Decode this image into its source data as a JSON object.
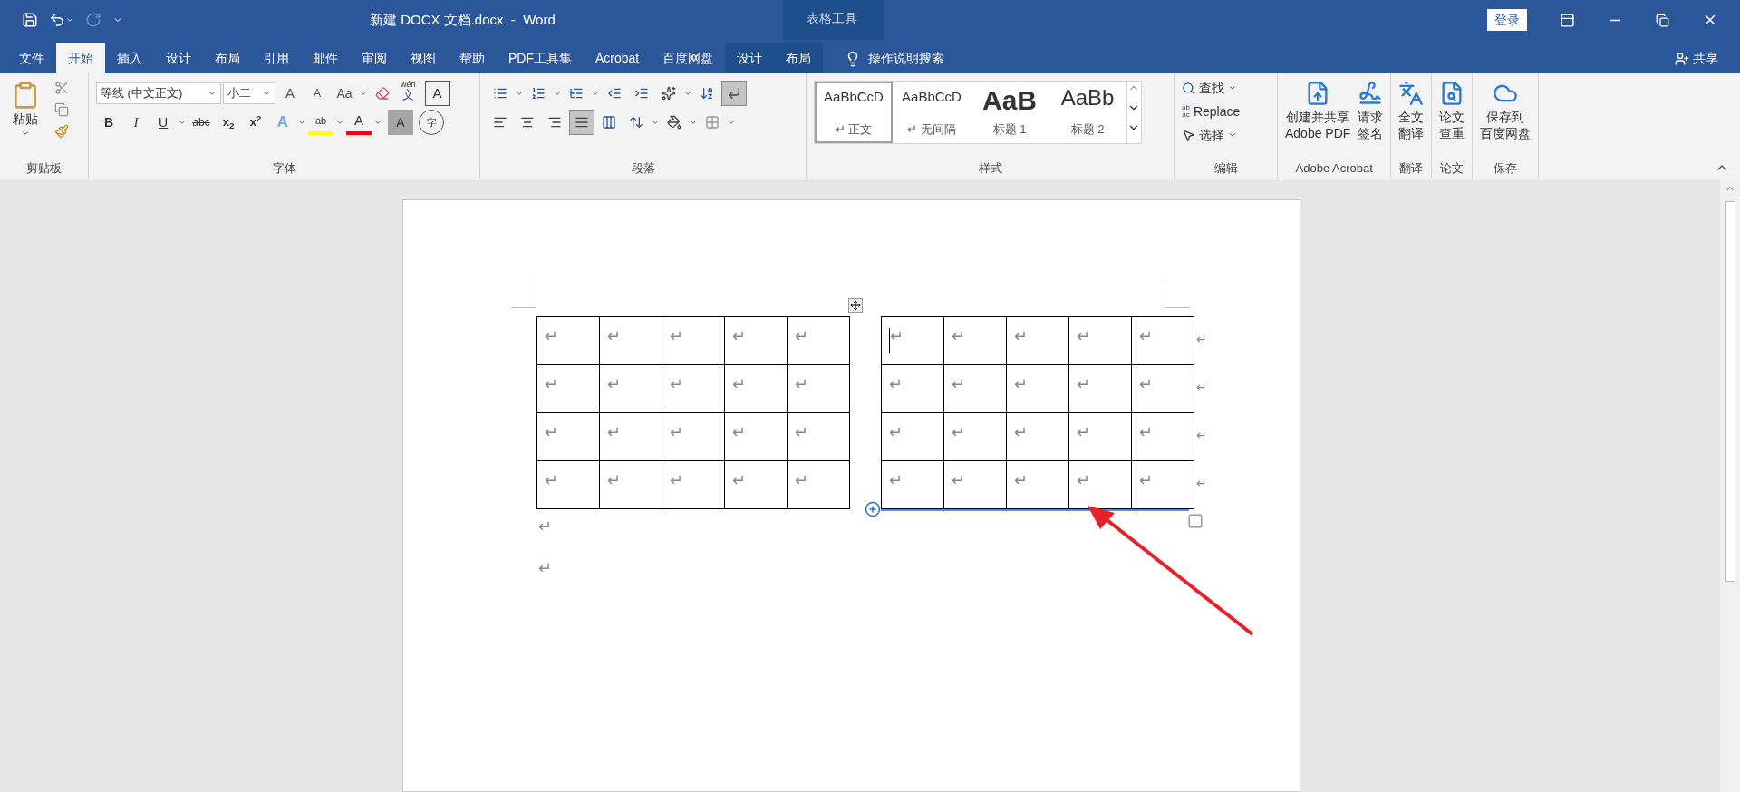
{
  "title_bar": {
    "title": "新建 DOCX 文档.docx  -  Word",
    "context_group": "表格工具",
    "sign_in": "登录"
  },
  "tabs": [
    {
      "label": "文件",
      "selected": false,
      "contextual": false
    },
    {
      "label": "开始",
      "selected": true,
      "contextual": false
    },
    {
      "label": "插入",
      "selected": false,
      "contextual": false
    },
    {
      "label": "设计",
      "selected": false,
      "contextual": false
    },
    {
      "label": "布局",
      "selected": false,
      "contextual": false
    },
    {
      "label": "引用",
      "selected": false,
      "contextual": false
    },
    {
      "label": "邮件",
      "selected": false,
      "contextual": false
    },
    {
      "label": "审阅",
      "selected": false,
      "contextual": false
    },
    {
      "label": "视图",
      "selected": false,
      "contextual": false
    },
    {
      "label": "帮助",
      "selected": false,
      "contextual": false
    },
    {
      "label": "PDF工具集",
      "selected": false,
      "contextual": false
    },
    {
      "label": "Acrobat",
      "selected": false,
      "contextual": false
    },
    {
      "label": "百度网盘",
      "selected": false,
      "contextual": false
    },
    {
      "label": "设计",
      "selected": false,
      "contextual": true
    },
    {
      "label": "布局",
      "selected": false,
      "contextual": true
    }
  ],
  "tell_me": "操作说明搜索",
  "share": "共享",
  "clipboard": {
    "paste": "粘贴",
    "label": "剪贴板"
  },
  "font": {
    "font_name": "等线 (中文正文)",
    "font_size": "小二",
    "grow": "A",
    "shrink": "A",
    "change_case": "Aa",
    "phonetic_top": "wén",
    "phonetic_bottom": "文",
    "char_border": "A",
    "bold": "B",
    "italic": "I",
    "underline": "U",
    "strike": "abc",
    "subscript": "x$_{2}$",
    "superscript": "x$^{2}$",
    "text_effects": "A",
    "highlight": "ab",
    "font_color": "A",
    "shading": "A",
    "enclose": "字",
    "label": "字体"
  },
  "paragraph": {
    "show_marks": true,
    "alignment": [
      {
        "kind": "left",
        "selected": false
      },
      {
        "kind": "center",
        "selected": false
      },
      {
        "kind": "right",
        "selected": false
      },
      {
        "kind": "justify",
        "selected": true
      },
      {
        "kind": "distributed",
        "selected": false
      }
    ],
    "label": "段落"
  },
  "styles": {
    "items": [
      {
        "preview": "AaBbCcD",
        "name": "正文",
        "mark": "↵",
        "kind": "normal",
        "selected": true
      },
      {
        "preview": "AaBbCcD",
        "name": "无间隔",
        "mark": "↵",
        "kind": "normal",
        "selected": false
      },
      {
        "preview": "AaB",
        "name": "标题 1",
        "kind": "heading1",
        "selected": false
      },
      {
        "preview": "AaBb",
        "name": "标题 2",
        "kind": "heading2",
        "selected": false
      }
    ],
    "label": "样式"
  },
  "editing": {
    "find": "查找",
    "replace": "Replace",
    "replace_icon_top": "ab",
    "replace_icon_bottom": "ac",
    "select": "选择",
    "label": "编辑"
  },
  "addin_groups": [
    {
      "label": "Adobe Acrobat",
      "buttons": [
        {
          "kind": "pdf",
          "lines": [
            "创建并共享",
            "Adobe PDF"
          ]
        },
        {
          "kind": "sign",
          "lines": [
            "请求",
            "签名"
          ]
        }
      ]
    },
    {
      "label": "翻译",
      "buttons": [
        {
          "kind": "translate",
          "lines": [
            "全文",
            "翻译"
          ]
        }
      ]
    },
    {
      "label": "论文",
      "buttons": [
        {
          "kind": "check",
          "lines": [
            "论文",
            "查重"
          ]
        }
      ]
    },
    {
      "label": "保存",
      "buttons": [
        {
          "kind": "cloud",
          "lines": [
            "保存到",
            "百度网盘"
          ]
        }
      ]
    }
  ],
  "tables": [
    {
      "active": false,
      "rows": [
        {
          "cells": [
            {
              "text": "↵",
              "cursor": false
            },
            {
              "text": "↵",
              "cursor": false
            },
            {
              "text": "↵",
              "cursor": false
            },
            {
              "text": "↵",
              "cursor": false
            },
            {
              "text": "↵",
              "cursor": false
            }
          ]
        },
        {
          "cells": [
            {
              "text": "↵",
              "cursor": false
            },
            {
              "text": "↵",
              "cursor": false
            },
            {
              "text": "↵",
              "cursor": false
            },
            {
              "text": "↵",
              "cursor": false
            },
            {
              "text": "↵",
              "cursor": false
            }
          ]
        },
        {
          "cells": [
            {
              "text": "↵",
              "cursor": false
            },
            {
              "text": "↵",
              "cursor": false
            },
            {
              "text": "↵",
              "cursor": false
            },
            {
              "text": "↵",
              "cursor": false
            },
            {
              "text": "↵",
              "cursor": false
            }
          ]
        },
        {
          "cells": [
            {
              "text": "↵",
              "cursor": false
            },
            {
              "text": "↵",
              "cursor": false
            },
            {
              "text": "↵",
              "cursor": false
            },
            {
              "text": "↵",
              "cursor": false
            },
            {
              "text": "↵",
              "cursor": false
            }
          ]
        }
      ]
    },
    {
      "active": true,
      "rows": [
        {
          "cells": [
            {
              "text": "↵",
              "cursor": true
            },
            {
              "text": "↵",
              "cursor": false
            },
            {
              "text": "↵",
              "cursor": false
            },
            {
              "text": "↵",
              "cursor": false
            },
            {
              "text": "↵",
              "cursor": false
            }
          ],
          "end_mark": "↵"
        },
        {
          "cells": [
            {
              "text": "↵",
              "cursor": false
            },
            {
              "text": "↵",
              "cursor": false
            },
            {
              "text": "↵",
              "cursor": false
            },
            {
              "text": "↵",
              "cursor": false
            },
            {
              "text": "↵",
              "cursor": false
            }
          ],
          "end_mark": "↵"
        },
        {
          "cells": [
            {
              "text": "↵",
              "cursor": false
            },
            {
              "text": "↵",
              "cursor": false
            },
            {
              "text": "↵",
              "cursor": false
            },
            {
              "text": "↵",
              "cursor": false
            },
            {
              "text": "↵",
              "cursor": false
            }
          ],
          "end_mark": "↵"
        },
        {
          "cells": [
            {
              "text": "↵",
              "cursor": false
            },
            {
              "text": "↵",
              "cursor": false
            },
            {
              "text": "↵",
              "cursor": false
            },
            {
              "text": "↵",
              "cursor": false
            },
            {
              "text": "↵",
              "cursor": false
            }
          ],
          "end_mark": "↵"
        }
      ]
    }
  ],
  "paragraph_marks": [
    "↵",
    "↵"
  ]
}
